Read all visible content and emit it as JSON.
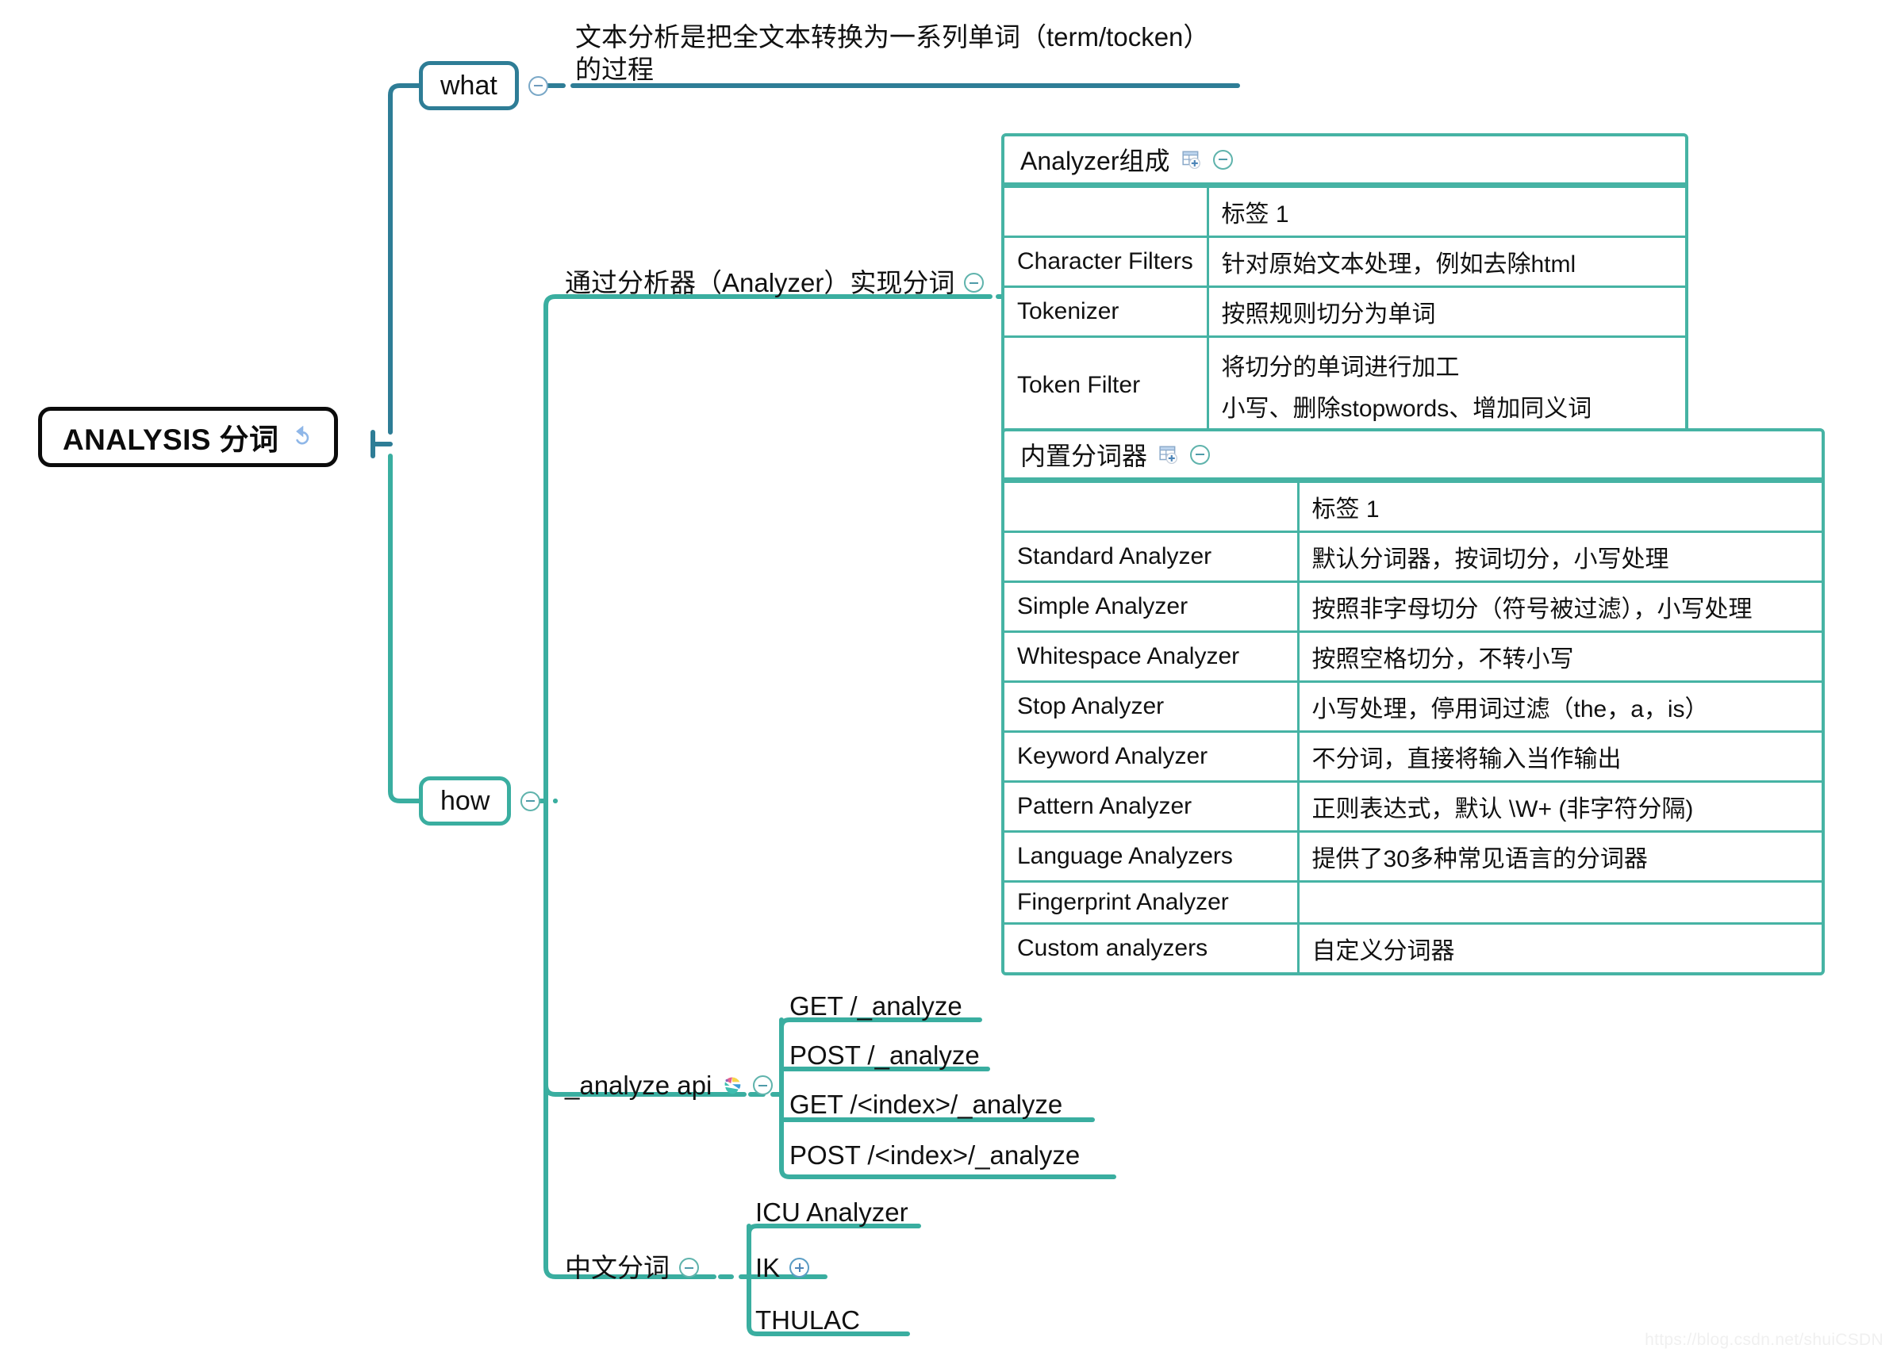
{
  "root": {
    "label": "ANALYSIS 分词",
    "icon": "refresh-curl-icon"
  },
  "branches": {
    "what": {
      "label": "what",
      "detail": "文本分析是把全文本转换为一系列单词（term/tocken）的过程"
    },
    "how": {
      "label": "how"
    }
  },
  "analyzer_branch": {
    "label": "通过分析器（Analyzer）实现分词"
  },
  "analyzer_composition": {
    "title": "Analyzer组成",
    "title_icon": "table-add-icon",
    "collapse_icon": "collapse-minus-icon",
    "columns": [
      "",
      "标签 1"
    ],
    "rows": [
      {
        "name": "Character Filters",
        "desc": [
          "针对原始文本处理，例如去除html"
        ]
      },
      {
        "name": "Tokenizer",
        "desc": [
          "按照规则切分为单词"
        ]
      },
      {
        "name": "Token Filter",
        "desc": [
          "将切分的单词进行加工",
          "小写、删除stopwords、增加同义词"
        ]
      }
    ]
  },
  "builtin_analyzers": {
    "title": "内置分词器",
    "title_icon": "table-add-icon",
    "collapse_icon": "collapse-minus-icon",
    "columns": [
      "",
      "标签 1"
    ],
    "rows": [
      {
        "name": "Standard Analyzer",
        "desc": "默认分词器，按词切分，小写处理"
      },
      {
        "name": "Simple Analyzer",
        "desc": "按照非字母切分（符号被过滤），小写处理"
      },
      {
        "name": "Whitespace Analyzer",
        "desc": "按照空格切分，不转小写"
      },
      {
        "name": "Stop Analyzer",
        "desc": "小写处理，停用词过滤（the，a，is）"
      },
      {
        "name": "Keyword Analyzer",
        "desc": "不分词，直接将输入当作输出"
      },
      {
        "name": "Pattern Analyzer",
        "desc": "正则表达式，默认 \\W+ (非字符分隔)"
      },
      {
        "name": "Language Analyzers",
        "desc": "提供了30多种常见语言的分词器"
      },
      {
        "name": "Fingerprint Analyzer",
        "desc": ""
      },
      {
        "name": "Custom analyzers",
        "desc": "自定义分词器"
      }
    ]
  },
  "analyze_api": {
    "label": "_analyze api",
    "icon": "elasticsearch-logo-icon",
    "collapse_icon": "collapse-minus-icon",
    "items": [
      "GET /_analyze",
      "POST /_analyze",
      "GET /<index>/_analyze",
      "POST /<index>/_analyze"
    ]
  },
  "chinese_segmentation": {
    "label": "中文分词",
    "collapse_icon": "collapse-minus-icon",
    "items": [
      {
        "label": "ICU Analyzer",
        "icon": null
      },
      {
        "label": "IK",
        "icon": "expand-plus-icon"
      },
      {
        "label": "THULAC",
        "icon": null
      }
    ]
  },
  "watermark": "https://blog.csdn.net/shuiCSDN",
  "colors": {
    "root_border": "#0b0b0b",
    "what_border": "#2e7d96",
    "teal": "#46b3a4",
    "teal_line": "#3aaea0",
    "blue_line": "#2e7d96"
  }
}
